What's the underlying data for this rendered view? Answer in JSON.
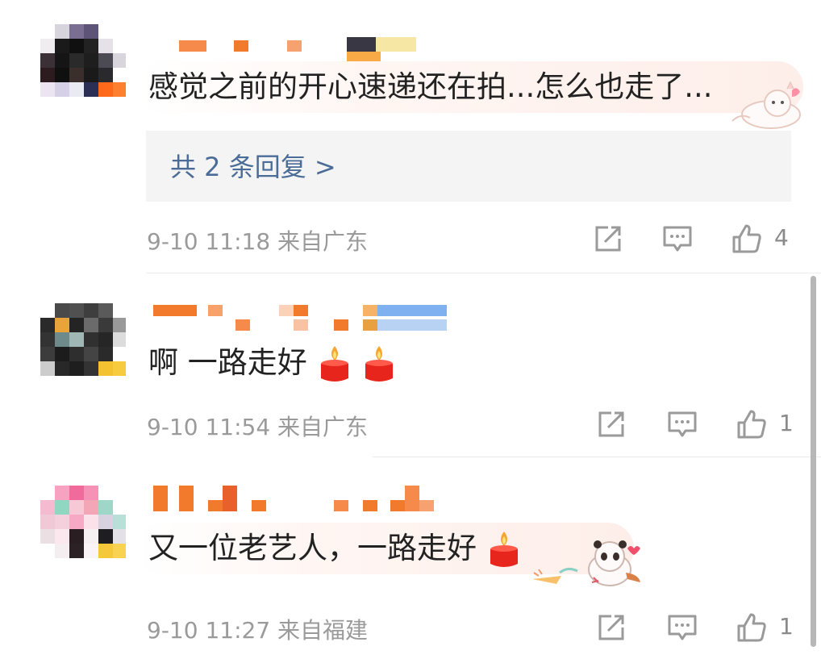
{
  "comments": [
    {
      "text": "感觉之前的开心速递还在拍...怎么也走了...",
      "reply_summary": "共 2 条回复 >",
      "time": "9-10 11:18",
      "location": "来自广东",
      "likes": "4"
    },
    {
      "text": "啊 一路走好",
      "time": "9-10 11:54",
      "location": "来自广东",
      "likes": "1"
    },
    {
      "text": "又一位老艺人，一路走好",
      "time": "9-10 11:27",
      "location": "来自福建",
      "likes": "1"
    }
  ],
  "icons": {
    "share": "share-icon",
    "comment": "comment-icon",
    "like": "thumbs-up-icon",
    "candle": "candle-emoji-icon"
  },
  "colors": {
    "reply_link": "#4a6c96",
    "meta_text": "#9a9a9a",
    "body_text": "#222222"
  }
}
